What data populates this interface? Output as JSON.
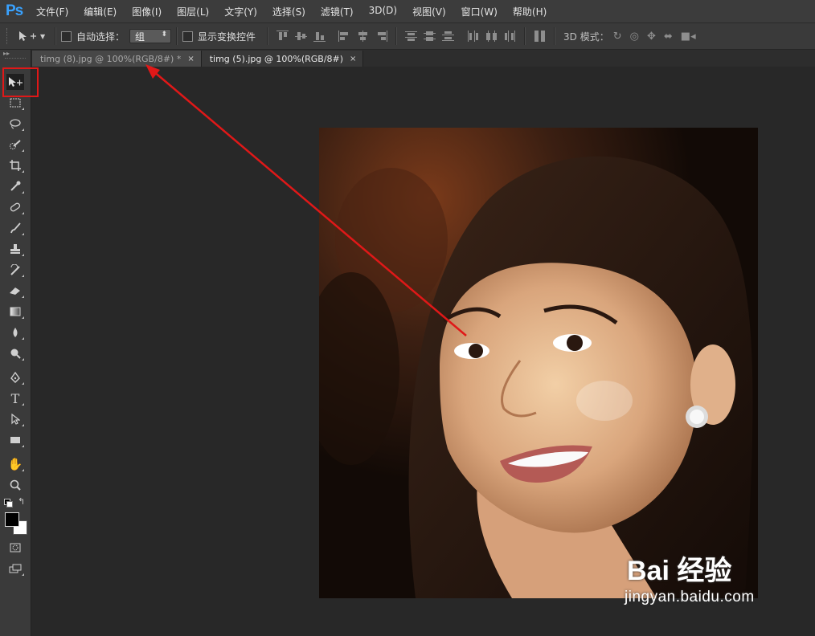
{
  "app": {
    "logo": "Ps"
  },
  "menu": [
    "文件(F)",
    "编辑(E)",
    "图像(I)",
    "图层(L)",
    "文字(Y)",
    "选择(S)",
    "滤镜(T)",
    "3D(D)",
    "视图(V)",
    "窗口(W)",
    "帮助(H)"
  ],
  "options": {
    "auto_select_label": "自动选择：",
    "auto_select_value": "组",
    "show_transform_label": "显示变换控件",
    "mode_label": "3D 模式："
  },
  "tabs": [
    {
      "label": "timg (8).jpg @ 100%(RGB/8#) *",
      "close": "×"
    },
    {
      "label": "timg (5).jpg @ 100%(RGB/8#)",
      "close": "×"
    }
  ],
  "tools": [
    "move-tool",
    "marquee-tool",
    "lasso-tool",
    "quick-selection-tool",
    "crop-tool",
    "eyedropper-tool",
    "healing-brush-tool",
    "brush-tool",
    "clone-stamp-tool",
    "history-brush-tool",
    "eraser-tool",
    "gradient-tool",
    "blur-tool",
    "dodge-tool",
    "pen-tool",
    "type-tool",
    "path-selection-tool",
    "rectangle-tool",
    "hand-tool",
    "zoom-tool"
  ],
  "type_tool_glyph": "T",
  "colors": {
    "foreground": "#000000",
    "background": "#ffffff",
    "annotation": "#e01818",
    "accent": "#39a2ff"
  },
  "watermark": {
    "title": "Bai 经验",
    "url": "jingyan.baidu.com"
  }
}
